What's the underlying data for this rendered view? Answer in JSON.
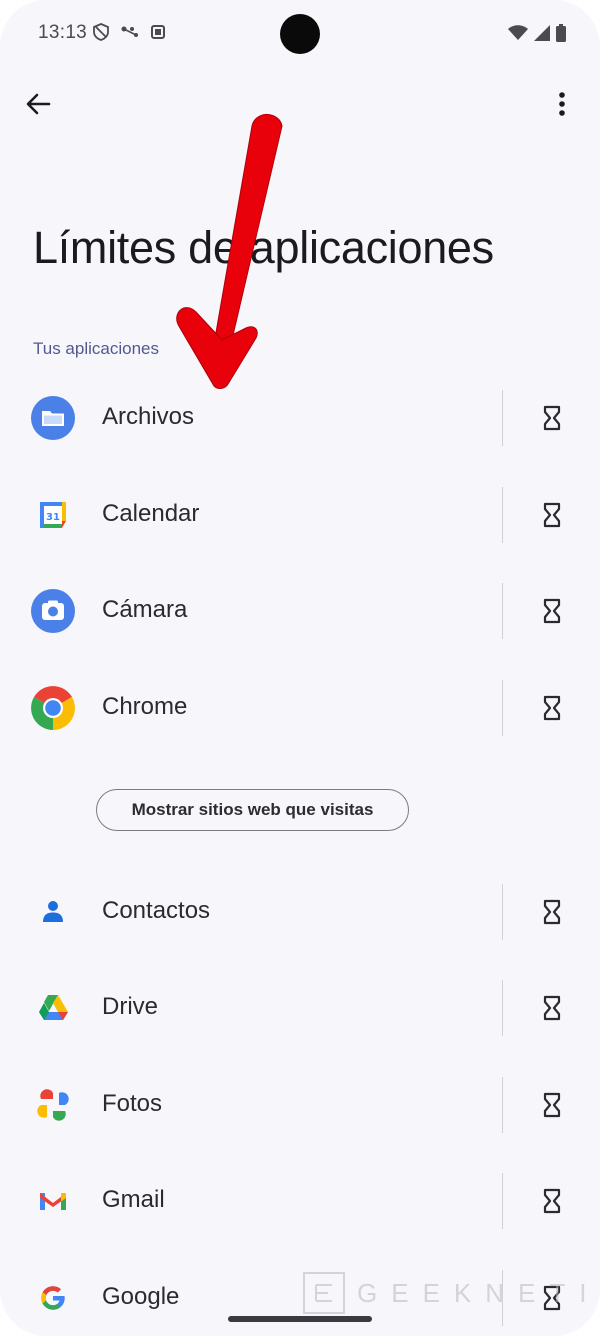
{
  "status_bar": {
    "time": "13:13",
    "left_icons": [
      "privacy-shield-icon",
      "vpn-key-icon",
      "app-notification-icon"
    ],
    "right_icons": [
      "wifi-icon",
      "cell-signal-icon",
      "battery-icon"
    ]
  },
  "toolbar": {
    "back_icon": "arrow-back-icon",
    "more_icon": "more-vert-icon"
  },
  "page": {
    "title": "Límites de aplicaciones",
    "section_header": "Tus aplicaciones"
  },
  "apps": [
    {
      "label": "Archivos",
      "icon": "files-icon"
    },
    {
      "label": "Calendar",
      "icon": "calendar-icon"
    },
    {
      "label": "Cámara",
      "icon": "camera-icon"
    },
    {
      "label": "Chrome",
      "icon": "chrome-icon"
    },
    {
      "label": "Contactos",
      "icon": "contacts-icon"
    },
    {
      "label": "Drive",
      "icon": "drive-icon"
    },
    {
      "label": "Fotos",
      "icon": "photos-icon"
    },
    {
      "label": "Gmail",
      "icon": "gmail-icon"
    },
    {
      "label": "Google",
      "icon": "google-icon"
    }
  ],
  "websites_button": {
    "label": "Mostrar sitios web que visitas"
  },
  "watermark": {
    "text": "GEEKNETIC"
  },
  "colors": {
    "background": "#f7f6fb",
    "section_header": "#505a8e",
    "annotation_arrow": "#e8000b"
  }
}
